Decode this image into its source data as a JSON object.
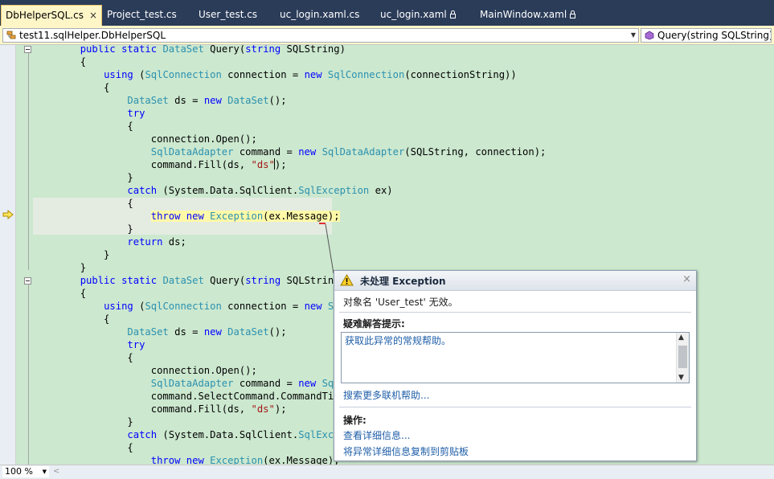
{
  "tabs": [
    {
      "label": "DbHelperSQL.cs",
      "active": true,
      "close": "×"
    },
    {
      "label": "Project_test.cs"
    },
    {
      "label": "User_test.cs"
    },
    {
      "label": "uc_login.xaml.cs"
    },
    {
      "label": "uc_login.xaml",
      "locked": true
    },
    {
      "label": "MainWindow.xaml",
      "locked": true
    }
  ],
  "navbar": {
    "type_combo": "test11.sqlHelper.DbHelperSQL",
    "member_combo": "Query(string SQLString)"
  },
  "code": {
    "lines": [
      "        public static DataSet Query(string SQLString)",
      "        {",
      "            using (SqlConnection connection = new SqlConnection(connectionString))",
      "            {",
      "                DataSet ds = new DataSet();",
      "                try",
      "                {",
      "                    connection.Open();",
      "                    SqlDataAdapter command = new SqlDataAdapter(SQLString, connection);",
      "                    command.Fill(ds, \"ds\");",
      "                }",
      "                catch (System.Data.SqlClient.SqlException ex)",
      "                {",
      "                    throw new Exception(ex.Message);",
      "                }",
      "                return ds;",
      "            }",
      "        }",
      "        public static DataSet Query(string SQLString,",
      "        {",
      "            using (SqlConnection connection = new SqlC",
      "            {",
      "                DataSet ds = new DataSet();",
      "                try",
      "                {",
      "                    connection.Open();",
      "                    SqlDataAdapter command = new SqlDa",
      "                    command.SelectCommand.CommandTimeo",
      "                    command.Fill(ds, \"ds\");",
      "                }",
      "                catch (System.Data.SqlClient.SqlExcept",
      "                {",
      "                    throw new Exception(ex.Message);"
    ]
  },
  "status": {
    "zoom": "100 %"
  },
  "exception": {
    "title": "未处理 Exception",
    "message": "对象名 'User_test' 无效。",
    "troubleshooting_heading": "疑难解答提示:",
    "tips": [
      "获取此异常的常规帮助。"
    ],
    "search_link": "搜索更多联机帮助...",
    "actions_heading": "操作:",
    "actions": [
      "查看详细信息...",
      "将异常详细信息复制到剪贴板"
    ],
    "close": "×"
  },
  "colors": {
    "editor_background": "#cce8cf",
    "tab_strip": "#2b3c59",
    "active_tab": "#fff6c8",
    "keyword": "#0000ff",
    "type": "#2b91af",
    "string": "#a31515",
    "exception_highlight": "#fff9a8",
    "link": "#1f5ea8"
  },
  "icons": {
    "warning": "warning-icon",
    "next_statement": "next-statement-arrow-icon",
    "class": "class-icon",
    "method": "method-icon",
    "lock": "lock-icon"
  }
}
